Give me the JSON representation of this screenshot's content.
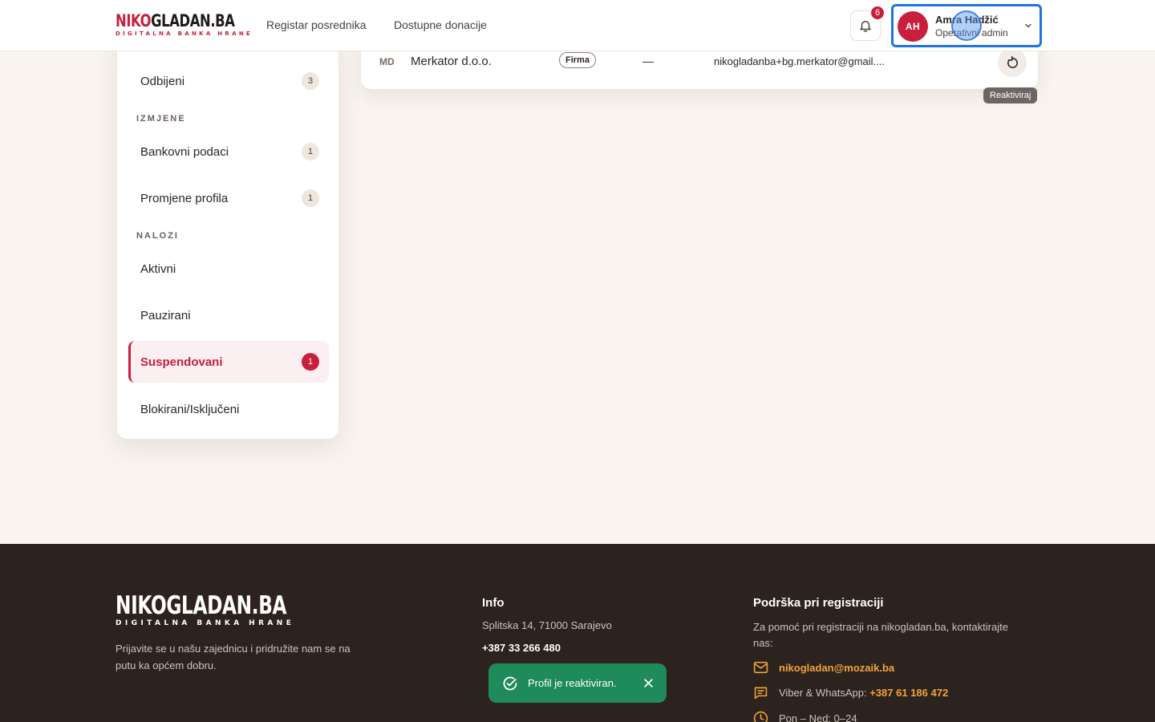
{
  "header": {
    "logo": {
      "part1": "NIKO",
      "part2": "GLADAN.BA",
      "tagline": "DIGITALNA BANKA HRANE"
    },
    "nav": [
      "Registar posrednika",
      "Dostupne donacije"
    ],
    "notifications_count": "6",
    "user": {
      "initials": "AH",
      "name": "Amra Hadžić",
      "role": "Operativni admin"
    }
  },
  "sidebar": {
    "top_item": {
      "label": "Odbijeni",
      "count": "3"
    },
    "sections": [
      {
        "title": "IZMJENE",
        "items": [
          {
            "label": "Bankovni podaci",
            "count": "1"
          },
          {
            "label": "Promjene profila",
            "count": "1"
          }
        ]
      },
      {
        "title": "NALOZI",
        "items": [
          {
            "label": "Aktivni"
          },
          {
            "label": "Pauzirani"
          },
          {
            "label": "Suspendovani",
            "count": "1",
            "active": true
          },
          {
            "label": "Blokirani/Isključeni"
          }
        ]
      }
    ]
  },
  "table": {
    "row": {
      "initials": "MD",
      "name": "Merkator d.o.o.",
      "type": "Firma",
      "phone": "—",
      "email": "nikogladanba+bg.merkator@gmail...."
    },
    "action_tooltip": "Reaktiviraj"
  },
  "footer": {
    "logo": {
      "main": "NIKOGLADAN.BA",
      "tagline": "DIGITALNA BANKA HRANE"
    },
    "tagline": "Prijavite se u našu zajednicu i pridružite nam se na putu ka općem dobru.",
    "info": {
      "title": "Info",
      "address": "Splitska 14, 71000 Sarajevo",
      "phone": "+387 33 266 480"
    },
    "support": {
      "title": "Podrška pri registraciji",
      "text": "Za pomoć pri registraciji na nikogladan.ba, kontaktirajte nas:",
      "email": "nikogladan@mozaik.ba",
      "viber_label": "Viber & WhatsApp:",
      "viber_number": "+387 61 186 472",
      "hours": "Pon – Ned: 0–24"
    }
  },
  "toast": {
    "message": "Profil je reaktiviran."
  },
  "colors": {
    "brand_red": "#c8203c",
    "success_green": "#1f8a5a",
    "footer_bg": "#2c221e",
    "link_orange": "#f0a43a",
    "focus_blue": "#1f74e0"
  }
}
